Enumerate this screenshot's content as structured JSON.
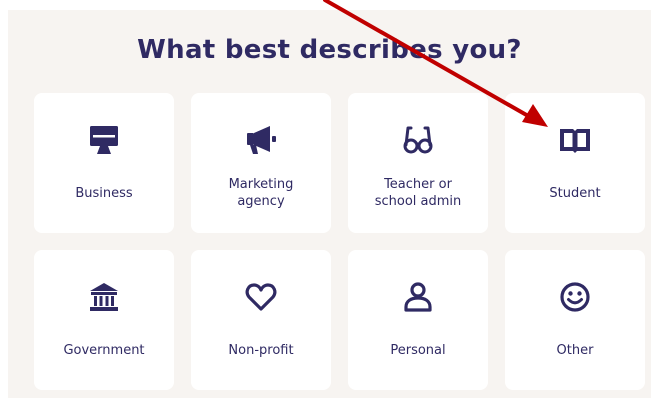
{
  "heading": "What best describes you?",
  "colors": {
    "panel_bg": "#f7f4f1",
    "card_bg": "#ffffff",
    "icon_and_text": "#2f2a63",
    "annotation_arrow": "#c00000"
  },
  "options": [
    {
      "label": "Business",
      "icon": "monitor-icon"
    },
    {
      "label": "Marketing\nagency",
      "icon": "megaphone-icon"
    },
    {
      "label": "Teacher or\nschool admin",
      "icon": "glasses-icon"
    },
    {
      "label": "Student",
      "icon": "open-book-icon"
    },
    {
      "label": "Government",
      "icon": "bank-building-icon"
    },
    {
      "label": "Non-profit",
      "icon": "heart-icon"
    },
    {
      "label": "Personal",
      "icon": "person-icon"
    },
    {
      "label": "Other",
      "icon": "smiley-face-icon"
    }
  ]
}
